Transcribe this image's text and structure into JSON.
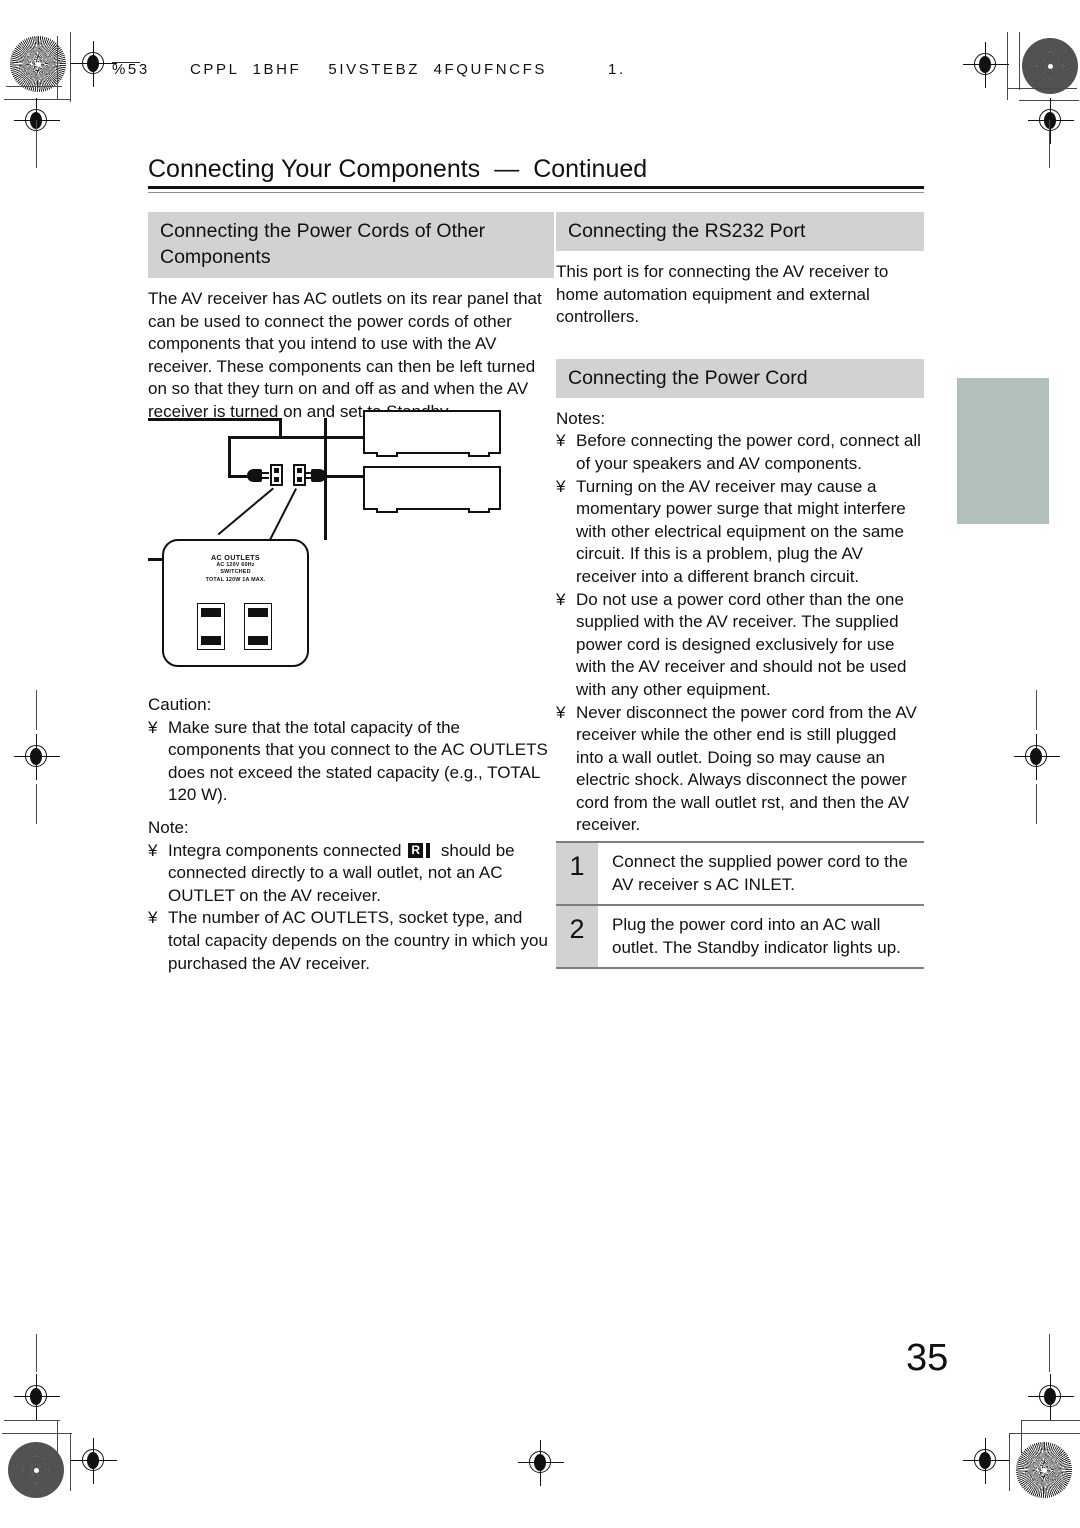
{
  "running_header": {
    "left_code": "%53",
    "text": "CPPL  1BHF    5IVSTEBZ  4FQUFNCFS",
    "page_marker": "1."
  },
  "page_title": {
    "main": "Connecting Your Components",
    "separator": "—",
    "continued": "Continued"
  },
  "left_column": {
    "section_heading": "Connecting the Power Cords of Other Components",
    "intro_paragraph": "The AV receiver has AC outlets on its rear panel that can be used to connect the power cords of other components that you intend to use with the AV receiver. These components can then be left turned on so that they turn on and off as and when the AV receiver is turned on and set to Standby.",
    "caution_label": "Caution:",
    "caution_bullets": [
      "Make sure that the total capacity of the components that you connect to the AC OUTLETS does not exceed the stated capacity (e.g., TOTAL 120 W)."
    ],
    "note_label": "Note:",
    "note_bullets": [
      {
        "before": "Integra components connected",
        "glyph": "ri-logo",
        "after": "should be connected directly to a wall outlet, not an AC OUTLET on the AV receiver."
      },
      {
        "before": "The number of AC OUTLETS, socket type, and total capacity depends on the country in which you purchased the AV receiver.",
        "glyph": "",
        "after": ""
      }
    ],
    "bullet_char": "¥"
  },
  "diagram": {
    "panel_label_line1": "AC OUTLETS",
    "panel_label_line2": "AC 120V 60Hz",
    "panel_label_line3": "SWITCHED",
    "panel_label_line4": "TOTAL 120W 1A MAX."
  },
  "right_column": {
    "rs232_heading": "Connecting the RS232 Port",
    "rs232_paragraph": "This port is for connecting the AV receiver to home automation equipment and external controllers.",
    "power_cord_heading": "Connecting the Power Cord",
    "notes_label": "Notes:",
    "notes": [
      "Before connecting the power cord, connect all of your speakers and AV components.",
      "Turning on the AV receiver may cause a momentary power surge that might interfere with other electrical equipment on the same circuit. If this is a problem, plug the AV receiver into a different branch circuit.",
      "Do not use a power cord other than the one supplied with the AV receiver. The supplied power cord is designed exclusively for use with the AV receiver and should not be used with any other equipment.",
      "Never disconnect the power cord from the AV receiver while the other end is still plugged into a wall outlet. Doing so may cause an electric shock. Always disconnect the power cord from the wall outlet  rst, and then the AV receiver."
    ],
    "bullet_char": "¥",
    "steps": [
      {
        "number": "1",
        "text": "Connect the supplied power cord to the AV receiver s AC INLET."
      },
      {
        "number": "2",
        "text": "Plug the power cord into an AC wall outlet. The Standby indicator lights up."
      }
    ]
  },
  "page_number": "35",
  "colors": {
    "heading_band": "#d2d2d2",
    "thumb_tab": "#b2c0bd",
    "rule": "#111111",
    "rule_light": "#8d8d8d",
    "step_divider": "#7d7d7d"
  }
}
